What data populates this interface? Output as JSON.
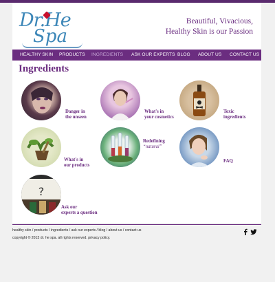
{
  "logo": {
    "line1": "Dr.He",
    "line2": "Spa"
  },
  "tagline": {
    "line1": "Beautiful, Vivacious,",
    "line2": "Healthy Skin is our Passion"
  },
  "nav": {
    "items": [
      {
        "label": "HEALTHY SKIN",
        "active": false
      },
      {
        "label": "PRODUCTS",
        "active": false
      },
      {
        "label": "INGREDIENTS",
        "active": true
      },
      {
        "label": "ASK OUR EXPERTS",
        "active": false
      },
      {
        "label": "BLOG",
        "active": false
      },
      {
        "label": "ABOUT US",
        "active": false
      },
      {
        "label": "CONTACT US",
        "active": false
      }
    ]
  },
  "main": {
    "heading": "Ingredients",
    "tiles": [
      {
        "line1": "Danger in",
        "line2": "the unseen",
        "icon": "woman-face-photo"
      },
      {
        "line1": "What's in",
        "line2": "your cosmetics",
        "icon": "woman-makeup-photo"
      },
      {
        "line1": "Toxic",
        "line2": "ingredients",
        "icon": "poison-bottle-photo"
      },
      {
        "line1": "What's in",
        "line2": "our products",
        "icon": "herbs-mortar-photo"
      },
      {
        "line1": "Redefining",
        "line2": "“natural”",
        "icon": "test-tubes-photo"
      },
      {
        "line1": "FAQ",
        "line2": "",
        "icon": "woman-thinking-photo"
      },
      {
        "line1": "Ask our",
        "line2": "experts a question",
        "icon": "question-mark-photo"
      }
    ]
  },
  "footer": {
    "links": "healthy skin  /  products  /  ingredients  /  ask our experts  /  blog  /  about us  /  contact us",
    "copyright": "copyright © 2013 dr. he spa. all rights reserved. privacy policy.",
    "social": [
      "facebook-icon",
      "twitter-icon"
    ]
  },
  "colors": {
    "brand": "#6b2d80",
    "logo": "#3d87b8"
  }
}
